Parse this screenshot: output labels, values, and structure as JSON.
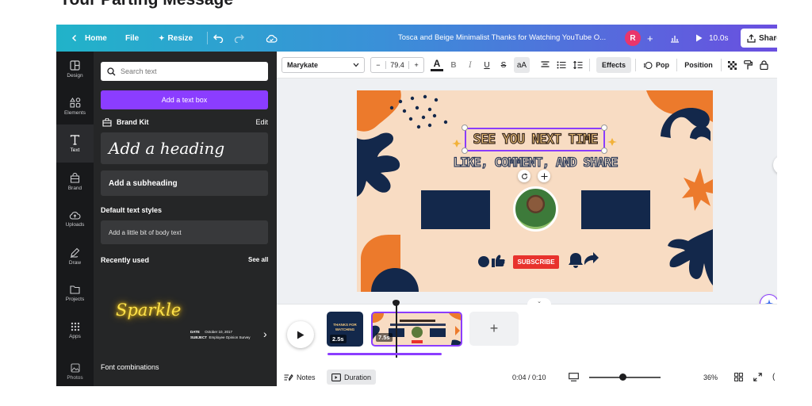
{
  "article": {
    "heading": "Your Parting Message"
  },
  "topbar": {
    "home": "Home",
    "file": "File",
    "resize": "Resize",
    "doc_title": "Tosca and Beige Minimalist Thanks for Watching YouTube O...",
    "avatar_initial": "R",
    "add_symbol": "+",
    "duration": "10.0s",
    "share": "Share"
  },
  "rail": {
    "items": [
      {
        "label": "Design",
        "icon": "design-icon"
      },
      {
        "label": "Elements",
        "icon": "elements-icon"
      },
      {
        "label": "Text",
        "icon": "text-icon"
      },
      {
        "label": "Brand",
        "icon": "brand-icon"
      },
      {
        "label": "Uploads",
        "icon": "upload-cloud-icon"
      },
      {
        "label": "Draw",
        "icon": "pen-icon"
      },
      {
        "label": "Projects",
        "icon": "folder-icon"
      },
      {
        "label": "Apps",
        "icon": "apps-grid-icon"
      },
      {
        "label": "Photos",
        "icon": "image-icon"
      }
    ],
    "active": "Text"
  },
  "panel": {
    "search_placeholder": "Search text",
    "add_text_box": "Add a text box",
    "brand_kit": "Brand Kit",
    "edit": "Edit",
    "add_heading": "Add a heading",
    "add_subheading": "Add a subheading",
    "default_styles": "Default text styles",
    "body_text": "Add a little bit of body text",
    "recently_used": "Recently used",
    "see_all": "See all",
    "sparkle": "Sparkle",
    "mini_doc": [
      {
        "k": "DATE",
        "v": "October 10, 2017"
      },
      {
        "k": "SUBJECT",
        "v": "Employee Opinion Survey"
      }
    ],
    "font_combinations": "Font combinations"
  },
  "toolbar": {
    "font": "Marykate",
    "size_minus": "−",
    "size_value": "79.4",
    "size_plus": "+",
    "effects": "Effects",
    "pop": "Pop",
    "position": "Position"
  },
  "canvas": {
    "line1": "SEE YOU NEXT TIME",
    "line2": "LIKE, COMMENT, AND SHARE",
    "subscribe": "SUBSCRIBE",
    "colors": {
      "peach": "#f8dcc3",
      "orange": "#ec7a2c",
      "navy": "#13284b",
      "accent": "#8b3dff",
      "red": "#e8322d"
    }
  },
  "timeline": {
    "clips": [
      {
        "label": "2.5s",
        "title": "THANKS FOR WATCHING"
      },
      {
        "label": "7.5s"
      }
    ],
    "add_symbol": "+",
    "progress": 0.4
  },
  "bottombar": {
    "notes": "Notes",
    "duration": "Duration",
    "time": "0:04 / 0:10",
    "zoom": "36%",
    "zoom_level": 0.36
  }
}
